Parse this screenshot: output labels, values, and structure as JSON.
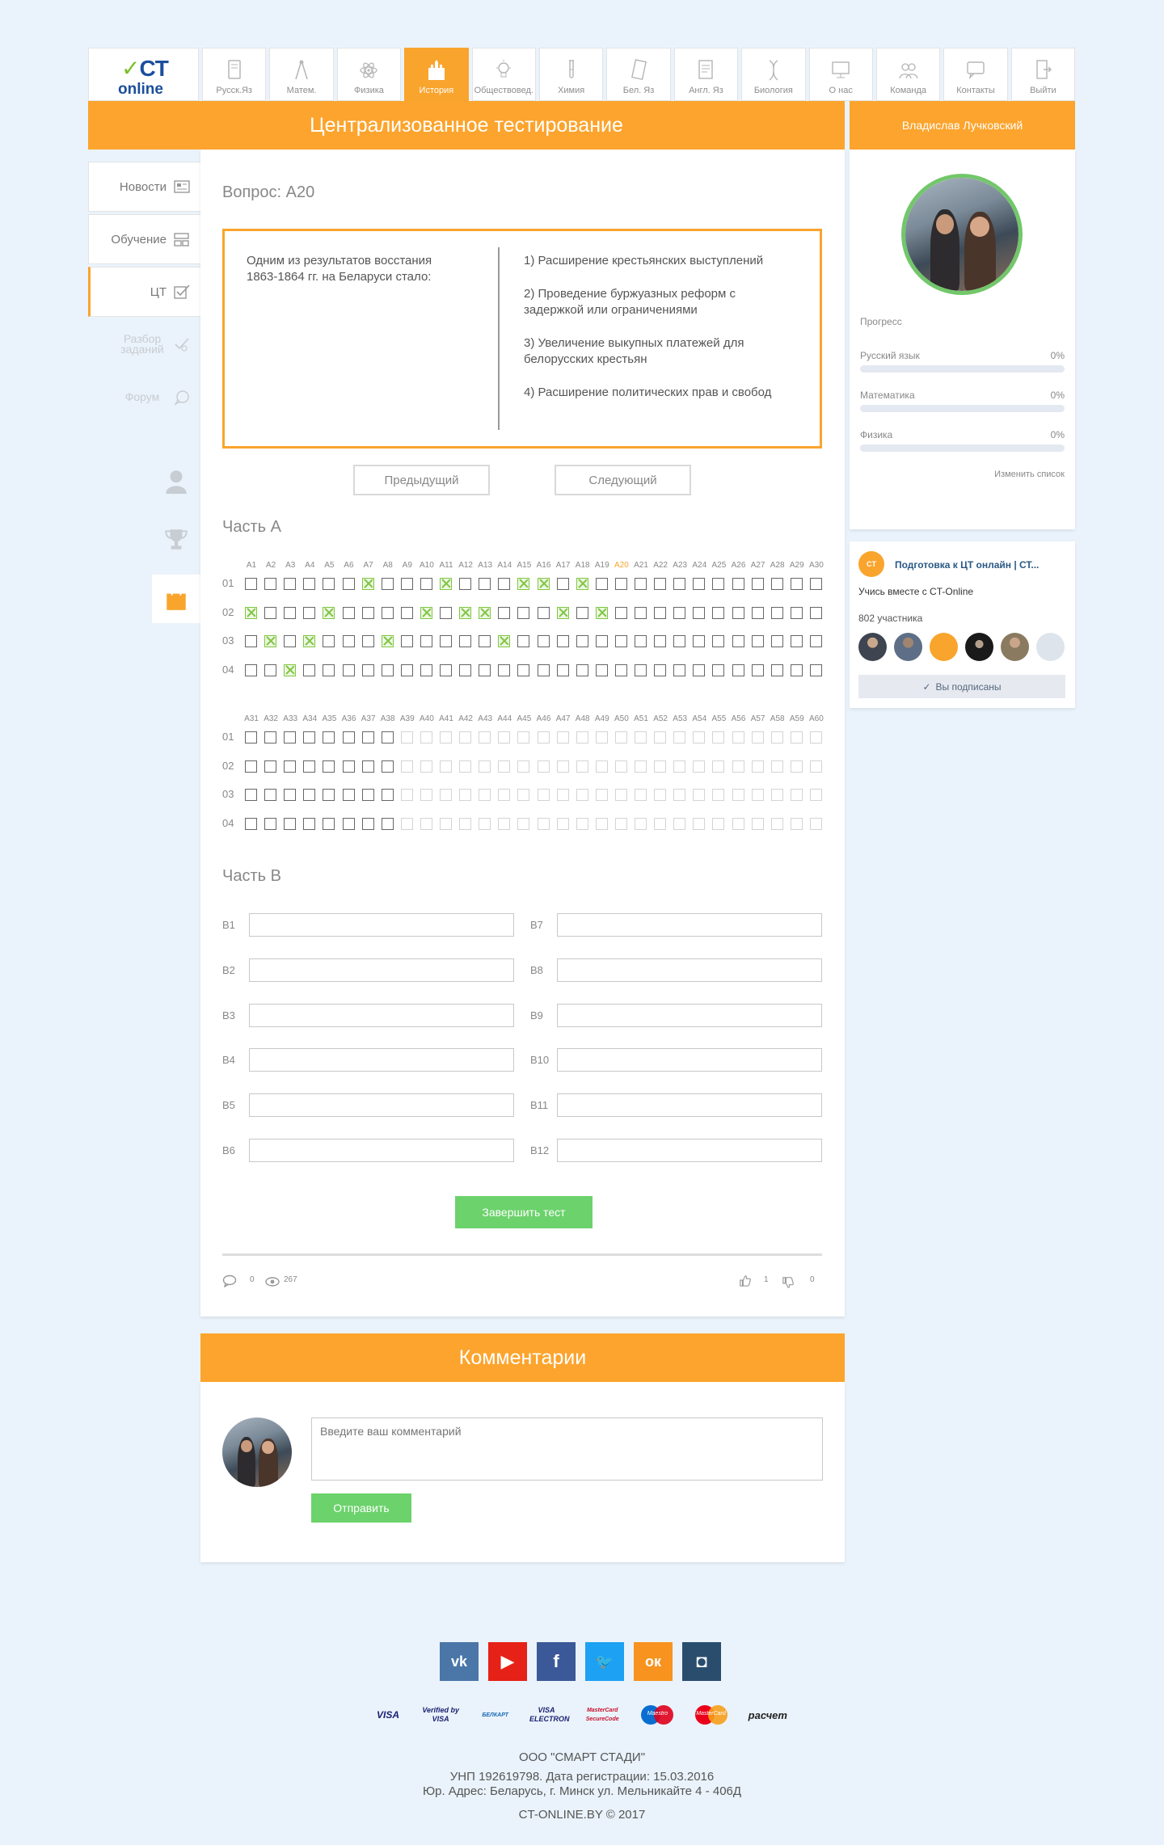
{
  "logo": {
    "ct": "CT",
    "online": "online",
    "check": "✓"
  },
  "nav_tabs": [
    {
      "label": "Русск.Яз",
      "icon": "book-icon",
      "active": false
    },
    {
      "label": "Матем.",
      "icon": "compass-icon",
      "active": false
    },
    {
      "label": "Физика",
      "icon": "atom-icon",
      "active": false
    },
    {
      "label": "История",
      "icon": "castle-icon",
      "active": true
    },
    {
      "label": "Обществовед.",
      "icon": "lightbulb-icon",
      "active": false
    },
    {
      "label": "Химия",
      "icon": "test-tube-icon",
      "active": false
    },
    {
      "label": "Бел. Яз",
      "icon": "notebook-icon",
      "active": false
    },
    {
      "label": "Англ. Яз",
      "icon": "english-book-icon",
      "active": false
    },
    {
      "label": "Биология",
      "icon": "dna-icon",
      "active": false
    },
    {
      "label": "О нас",
      "icon": "monitor-icon",
      "active": false
    },
    {
      "label": "Команда",
      "icon": "team-icon",
      "active": false
    },
    {
      "label": "Контакты",
      "icon": "chat-icon",
      "active": false
    },
    {
      "label": "Выйти",
      "icon": "exit-icon",
      "active": false
    }
  ],
  "header": {
    "title": "Централизованное тестирование",
    "user_name": "Владислав Лучковский"
  },
  "left_nav": [
    {
      "label": "Новости",
      "icon": "news-icon",
      "state": "normal"
    },
    {
      "label": "Обучение",
      "icon": "learning-icon",
      "state": "normal"
    },
    {
      "label": "ЦТ",
      "icon": "checkbox-icon",
      "state": "active"
    },
    {
      "label": "Разбор заданий",
      "icon": "check-pen-icon",
      "state": "muted"
    },
    {
      "label": "Форум",
      "icon": "forum-icon",
      "state": "muted"
    }
  ],
  "side_tools": [
    {
      "icon": "user-icon",
      "active": false
    },
    {
      "icon": "trophy-icon",
      "active": false
    },
    {
      "icon": "shopping-bag-icon",
      "active": true
    }
  ],
  "question": {
    "title": "Вопрос: А20",
    "text": "Одним из результатов восстания 1863-1864 гг. на Беларуси стало:",
    "answers": [
      "1) Расширение крестьянских выступлений",
      "2) Проведение буржуазных реформ с задержкой или ограничениями",
      "3) Увеличение выкупных платежей для белорусских крестьян",
      "4) Расширение политических прав и свобод"
    ]
  },
  "buttons": {
    "prev": "Предыдущий",
    "next": "Следующий",
    "finish": "Завершить тест",
    "send": "Отправить"
  },
  "part_a": {
    "title": "Часть А",
    "current": "A20",
    "row_labels": [
      "01",
      "02",
      "03",
      "04"
    ],
    "grid1_cols": [
      "A1",
      "A2",
      "A3",
      "A4",
      "A5",
      "A6",
      "A7",
      "A8",
      "A9",
      "A10",
      "A11",
      "A12",
      "A13",
      "A14",
      "A15",
      "A16",
      "A17",
      "A18",
      "A19",
      "A20",
      "A21",
      "A22",
      "A23",
      "A24",
      "A25",
      "A26",
      "A27",
      "A28",
      "A29",
      "A30"
    ],
    "grid2_cols": [
      "A31",
      "A32",
      "A33",
      "A34",
      "A35",
      "A36",
      "A37",
      "A38",
      "A39",
      "A40",
      "A41",
      "A42",
      "A43",
      "A44",
      "A45",
      "A46",
      "A47",
      "A48",
      "A49",
      "A50",
      "A51",
      "A52",
      "A53",
      "A54",
      "A55",
      "A56",
      "A57",
      "A58",
      "A59",
      "A60"
    ],
    "grid1_marked": {
      "01": [
        7,
        11,
        15,
        16,
        18
      ],
      "02": [
        1,
        5,
        10,
        12,
        13,
        17,
        19
      ],
      "03": [
        2,
        4,
        8,
        14
      ],
      "04": [
        3
      ]
    },
    "grid2_active_count": 8
  },
  "part_b": {
    "title": "Часть В",
    "left": [
      "B1",
      "B2",
      "B3",
      "B4",
      "B5",
      "B6"
    ],
    "right": [
      "B7",
      "B8",
      "B9",
      "B10",
      "B11",
      "B12"
    ]
  },
  "stats": {
    "comments": "0",
    "views": "267",
    "likes": "1",
    "dislikes": "0"
  },
  "comments": {
    "title": "Комментарии",
    "placeholder": "Введите ваш комментарий"
  },
  "progress": {
    "title": "Прогресс",
    "items": [
      {
        "name": "Русский язык",
        "value": "0%",
        "fraction": 0
      },
      {
        "name": "Математика",
        "value": "0%",
        "fraction": 0
      },
      {
        "name": "Физика",
        "value": "0%",
        "fraction": 0
      }
    ],
    "edit_link": "Изменить список"
  },
  "group": {
    "logo_text": "CT",
    "name": "Подготовка к ЦТ онлайн | СТ...",
    "description": "Учись вместе с CT-Online",
    "members": "802 участника",
    "subscribed": "Вы подписаны"
  },
  "social": [
    {
      "icon": "vk-icon",
      "glyph": "vk",
      "color": "#4a76a8"
    },
    {
      "icon": "youtube-icon",
      "glyph": "▶",
      "color": "#e62117"
    },
    {
      "icon": "facebook-icon",
      "glyph": "f",
      "color": "#3b5998"
    },
    {
      "icon": "twitter-icon",
      "glyph": "🐦",
      "color": "#1da1f2"
    },
    {
      "icon": "odnoklassniki-icon",
      "glyph": "ок",
      "color": "#f7931e"
    },
    {
      "icon": "instagram-icon",
      "glyph": "◘",
      "color": "#2a4d6e"
    }
  ],
  "payments": [
    "VISA",
    "Verified by VISA",
    "БЕЛКАРТ",
    "VISA ELECTRON",
    "MasterCard SecureCode",
    "Maestro",
    "MasterCard",
    "расчет"
  ],
  "footer": {
    "company": "ООО \"СМАРТ СТАДИ\"",
    "reg": "УНП 192619798. Дата регистрации: 15.03.2016",
    "address": "Юр. Адрес: Беларусь, г. Минск ул. Мельникайте 4 - 406Д",
    "copyright": "CT-ONLINE.BY © 2017"
  }
}
